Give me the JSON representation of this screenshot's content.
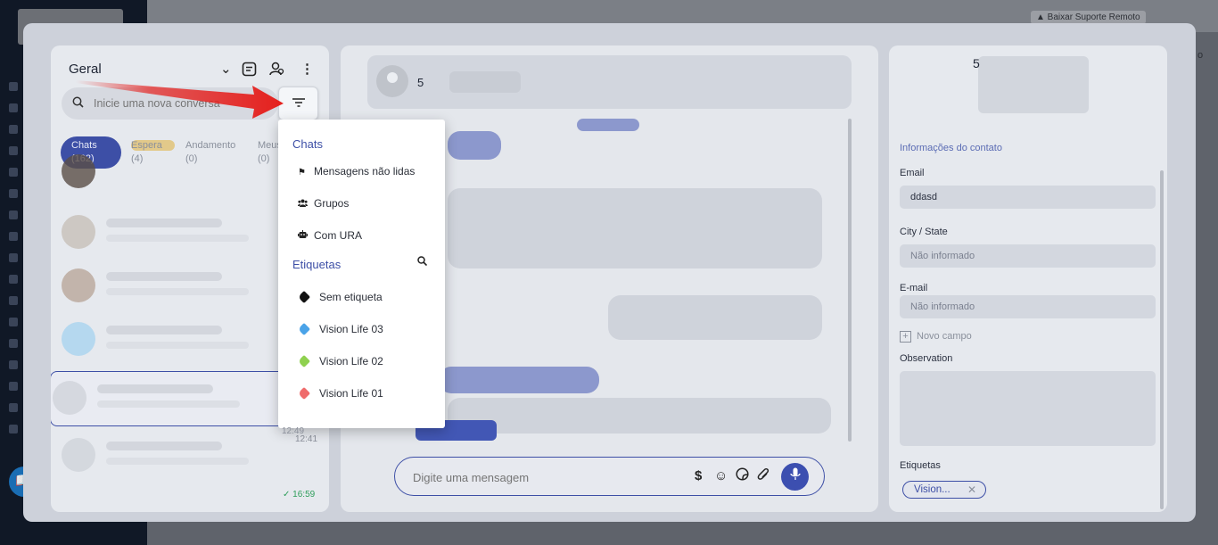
{
  "background": {
    "support_label": "▲ Baixar Suporte Remoto",
    "right_text": "o"
  },
  "left_panel": {
    "title": "Geral",
    "search_placeholder": "Inicie uma nova conversa",
    "tabs": [
      {
        "label": "Chats",
        "count": "(162)"
      },
      {
        "label": "Espera",
        "count": "(4)"
      },
      {
        "label": "Andamento",
        "count": "(0)"
      },
      {
        "label": "Meus",
        "count": "(0)"
      }
    ],
    "times": [
      "12:49",
      "12:41",
      "16:59"
    ]
  },
  "conversation": {
    "contact_initial": "5",
    "composer_placeholder": "Digite uma mensagem"
  },
  "contact_panel": {
    "name_initial": "5",
    "section_title": "Informações do contato",
    "fields": [
      {
        "label": "Email",
        "value": "ddasd"
      },
      {
        "label": "City / State",
        "value": "Não informado"
      },
      {
        "label": "E-mail",
        "value": "Não informado"
      }
    ],
    "add_field_label": "Novo campo",
    "observation_label": "Observation",
    "tags_label": "Etiquetas",
    "tag_chip": "Vision..."
  },
  "dropdown": {
    "chats_header": "Chats",
    "chat_filters": [
      "Mensagens não lidas",
      "Grupos",
      "Com URA"
    ],
    "tags_header": "Etiquetas",
    "tags": [
      {
        "label": "Sem etiqueta",
        "color": "#111111"
      },
      {
        "label": "Vision Life 03",
        "color": "#4aa3e8"
      },
      {
        "label": "Vision Life 02",
        "color": "#8fd14f"
      },
      {
        "label": "Vision Life 01",
        "color": "#ef6b6b"
      }
    ]
  },
  "colors": {
    "accent": "#3d4fa6",
    "annotation_arrow": "#e5201d"
  }
}
